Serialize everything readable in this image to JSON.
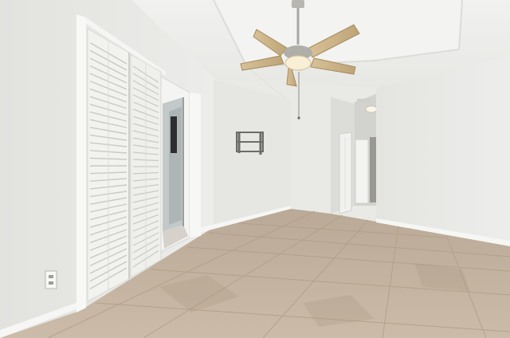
{
  "scene": {
    "kind": "photo",
    "subject": "empty-room",
    "objects": [
      {
        "name": "ceiling-fan-with-light",
        "icon": "ceiling-fan-icon"
      },
      {
        "name": "louvered-bifold-closet-doors",
        "icon": "louvered-door-icon"
      },
      {
        "name": "sliding-glass-door",
        "icon": "glass-door-icon"
      },
      {
        "name": "wall-tv-mount-bracket",
        "icon": "tv-mount-icon"
      },
      {
        "name": "hallway-door",
        "icon": "door-icon"
      },
      {
        "name": "hallway-ceiling-light",
        "icon": "light-icon"
      },
      {
        "name": "wall-outlet",
        "icon": "outlet-icon"
      },
      {
        "name": "stone-tile-floor",
        "icon": "tile-floor-icon"
      }
    ]
  },
  "colors": {
    "wall": "#e8e8e5",
    "wall_shadow": "#d6d6d2",
    "ceiling": "#eeeeec",
    "floor_base": "#c8b8a5",
    "floor_dark": "#a8957f",
    "grout": "#b3a390",
    "trim": "#f7f7f5",
    "louver": "#f2f2ef",
    "louver_shadow": "#cfcfca",
    "fan_blade": "#cdb488",
    "fan_metal": "#a9a7a2",
    "glass": "#b9c0c2",
    "bracket": "#6d6c69"
  }
}
